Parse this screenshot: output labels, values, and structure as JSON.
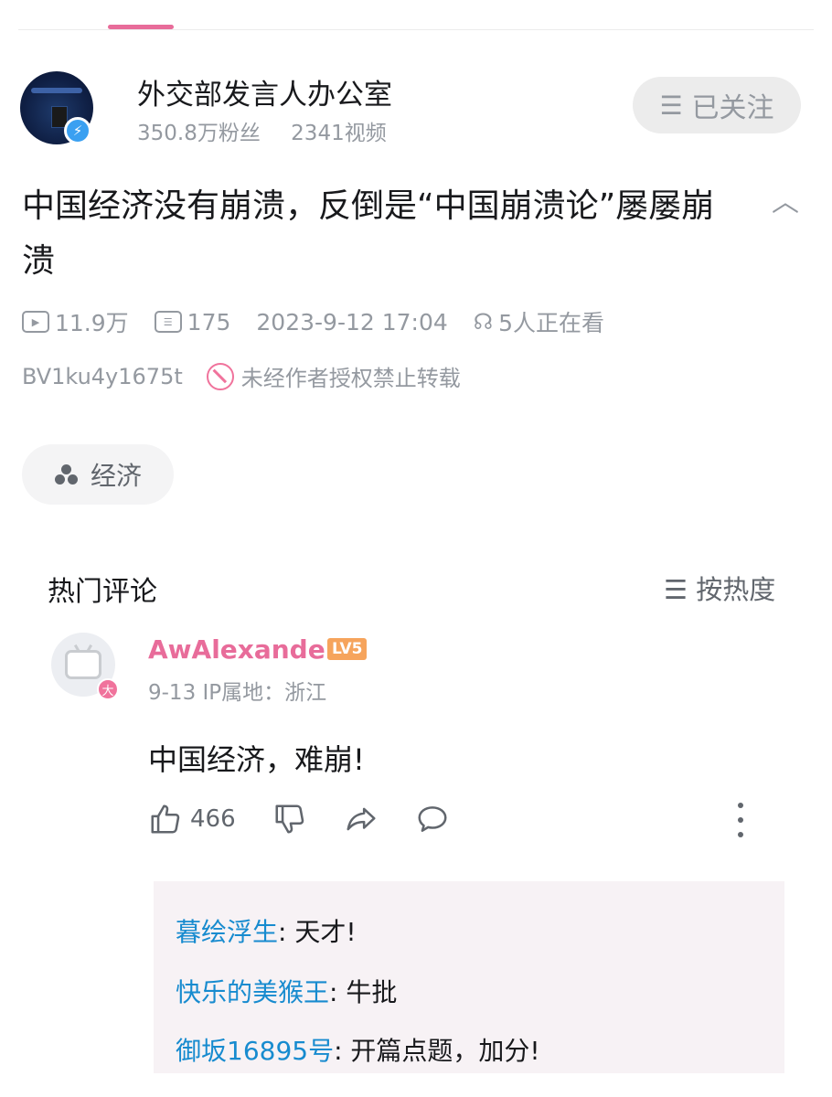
{
  "channel": {
    "name": "外交部发言人办公室",
    "followers": "350.8万粉丝",
    "videos": "2341视频",
    "follow_icon": "menu-icon",
    "follow_label": "已关注"
  },
  "video": {
    "title": "中国经济没有崩溃，反倒是“中国崩溃论”屡屡崩溃",
    "views": "11.9万",
    "danmaku": "175",
    "date": "2023-9-12 17:04",
    "watching": "5人正在看",
    "bvid": "BV1ku4y1675t",
    "copyright": "未经作者授权禁止转载"
  },
  "tag": {
    "label": "经济"
  },
  "comments": {
    "section_title": "热门评论",
    "sort_label": "按热度",
    "top": {
      "user": "AwAlexander",
      "level": "LV5",
      "date": "9-13",
      "ip": "IP属地：浙江",
      "text": "中国经济，难崩!",
      "likes": "466",
      "badge": "大"
    },
    "replies": [
      {
        "user": "暮绘浮生",
        "text": ": 天才!"
      },
      {
        "user": "快乐的美猴王",
        "text": ": 牛批"
      },
      {
        "user": "御坂16895号",
        "text": ": 开篇点题，加分!"
      }
    ]
  },
  "colors": {
    "accent_pink": "#e86c9a",
    "reply_name_blue": "#178bcf",
    "verify_blue": "#3aa0f1",
    "level_orange": "#f6a45c"
  }
}
